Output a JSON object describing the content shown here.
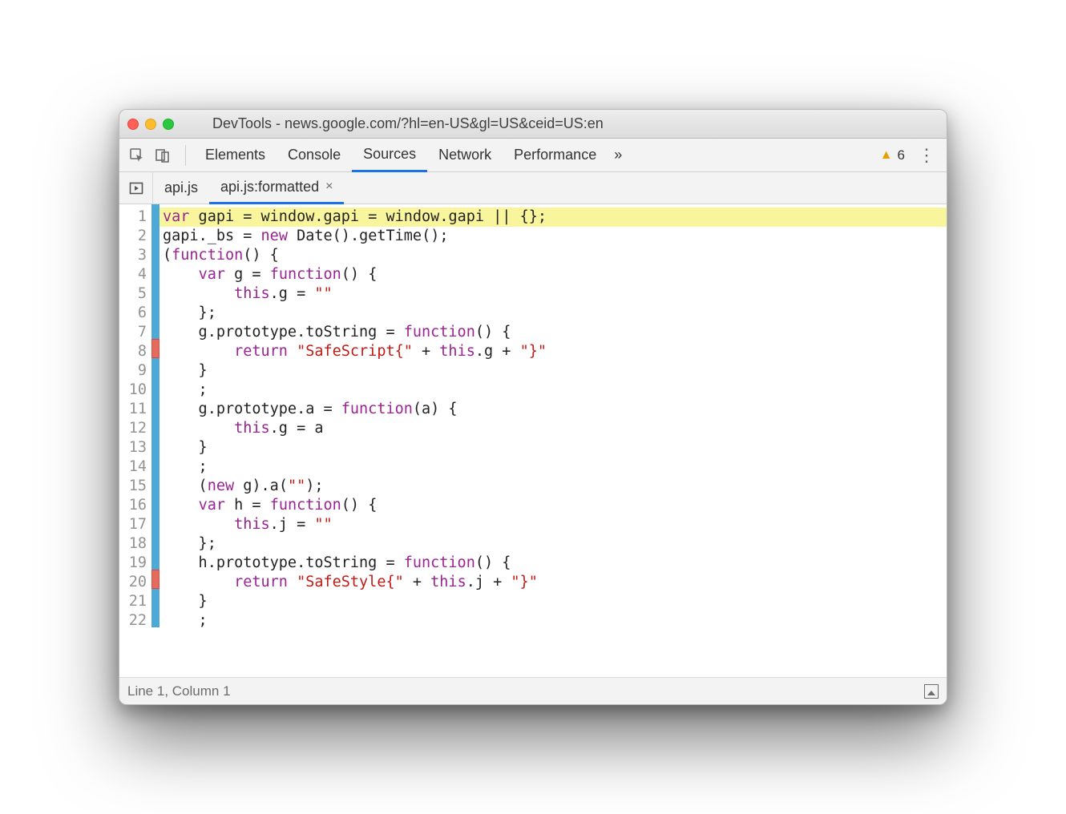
{
  "window": {
    "title": "DevTools - news.google.com/?hl=en-US&gl=US&ceid=US:en"
  },
  "toolbar": {
    "tabs": {
      "elements": "Elements",
      "console": "Console",
      "sources": "Sources",
      "network": "Network",
      "performance": "Performance"
    },
    "warning_count": "6"
  },
  "fileTabs": {
    "tab1": "api.js",
    "tab2": "api.js:formatted",
    "close_label": "×"
  },
  "status": {
    "position": "Line 1, Column 1"
  },
  "code": {
    "lineCount": 22,
    "marks": [
      "blue",
      "blue",
      "blue",
      "blue",
      "blue",
      "blue",
      "blue",
      "red",
      "blue",
      "blue",
      "blue",
      "blue",
      "blue",
      "blue",
      "blue",
      "blue",
      "blue",
      "blue",
      "blue",
      "red",
      "blue",
      "blue"
    ],
    "lines": [
      [
        [
          "kw",
          "var"
        ],
        [
          "pu",
          " gapi "
        ],
        [
          "op",
          "="
        ],
        [
          "pu",
          " window"
        ],
        [
          "pu",
          "."
        ],
        [
          "pu",
          "gapi "
        ],
        [
          "op",
          "="
        ],
        [
          "pu",
          " window"
        ],
        [
          "pu",
          "."
        ],
        [
          "pu",
          "gapi "
        ],
        [
          "op",
          "||"
        ],
        [
          "pu",
          " {};"
        ]
      ],
      [
        [
          "pu",
          "gapi"
        ],
        [
          "pu",
          "."
        ],
        [
          "pu",
          "_bs "
        ],
        [
          "op",
          "="
        ],
        [
          "pu",
          " "
        ],
        [
          "kw",
          "new"
        ],
        [
          "pu",
          " Date"
        ],
        [
          "pu",
          "()."
        ],
        [
          "pu",
          "getTime"
        ],
        [
          "pu",
          "();"
        ]
      ],
      [
        [
          "pu",
          "("
        ],
        [
          "kw",
          "function"
        ],
        [
          "pu",
          "() {"
        ]
      ],
      [
        [
          "pu",
          "    "
        ],
        [
          "kw",
          "var"
        ],
        [
          "pu",
          " g = "
        ],
        [
          "kw",
          "function"
        ],
        [
          "pu",
          "() {"
        ]
      ],
      [
        [
          "pu",
          "        "
        ],
        [
          "kw",
          "this"
        ],
        [
          "pu",
          ".g = "
        ],
        [
          "str",
          "\"\""
        ]
      ],
      [
        [
          "pu",
          "    };"
        ]
      ],
      [
        [
          "pu",
          "    g.prototype.toString = "
        ],
        [
          "kw",
          "function"
        ],
        [
          "pu",
          "() {"
        ]
      ],
      [
        [
          "pu",
          "        "
        ],
        [
          "kw",
          "return"
        ],
        [
          "pu",
          " "
        ],
        [
          "str",
          "\"SafeScript{\""
        ],
        [
          "pu",
          " + "
        ],
        [
          "kw",
          "this"
        ],
        [
          "pu",
          ".g + "
        ],
        [
          "str",
          "\"}\""
        ]
      ],
      [
        [
          "pu",
          "    }"
        ]
      ],
      [
        [
          "pu",
          "    ;"
        ]
      ],
      [
        [
          "pu",
          "    g.prototype.a = "
        ],
        [
          "kw",
          "function"
        ],
        [
          "pu",
          "(a) {"
        ]
      ],
      [
        [
          "pu",
          "        "
        ],
        [
          "kw",
          "this"
        ],
        [
          "pu",
          ".g = a"
        ]
      ],
      [
        [
          "pu",
          "    }"
        ]
      ],
      [
        [
          "pu",
          "    ;"
        ]
      ],
      [
        [
          "pu",
          "    ("
        ],
        [
          "kw",
          "new"
        ],
        [
          "pu",
          " g).a("
        ],
        [
          "str",
          "\"\""
        ],
        [
          "pu",
          ");"
        ]
      ],
      [
        [
          "pu",
          "    "
        ],
        [
          "kw",
          "var"
        ],
        [
          "pu",
          " h = "
        ],
        [
          "kw",
          "function"
        ],
        [
          "pu",
          "() {"
        ]
      ],
      [
        [
          "pu",
          "        "
        ],
        [
          "kw",
          "this"
        ],
        [
          "pu",
          ".j = "
        ],
        [
          "str",
          "\"\""
        ]
      ],
      [
        [
          "pu",
          "    };"
        ]
      ],
      [
        [
          "pu",
          "    h.prototype.toString = "
        ],
        [
          "kw",
          "function"
        ],
        [
          "pu",
          "() {"
        ]
      ],
      [
        [
          "pu",
          "        "
        ],
        [
          "kw",
          "return"
        ],
        [
          "pu",
          " "
        ],
        [
          "str",
          "\"SafeStyle{\""
        ],
        [
          "pu",
          " + "
        ],
        [
          "kw",
          "this"
        ],
        [
          "pu",
          ".j + "
        ],
        [
          "str",
          "\"}\""
        ]
      ],
      [
        [
          "pu",
          "    }"
        ]
      ],
      [
        [
          "pu",
          "    ;"
        ]
      ]
    ]
  }
}
